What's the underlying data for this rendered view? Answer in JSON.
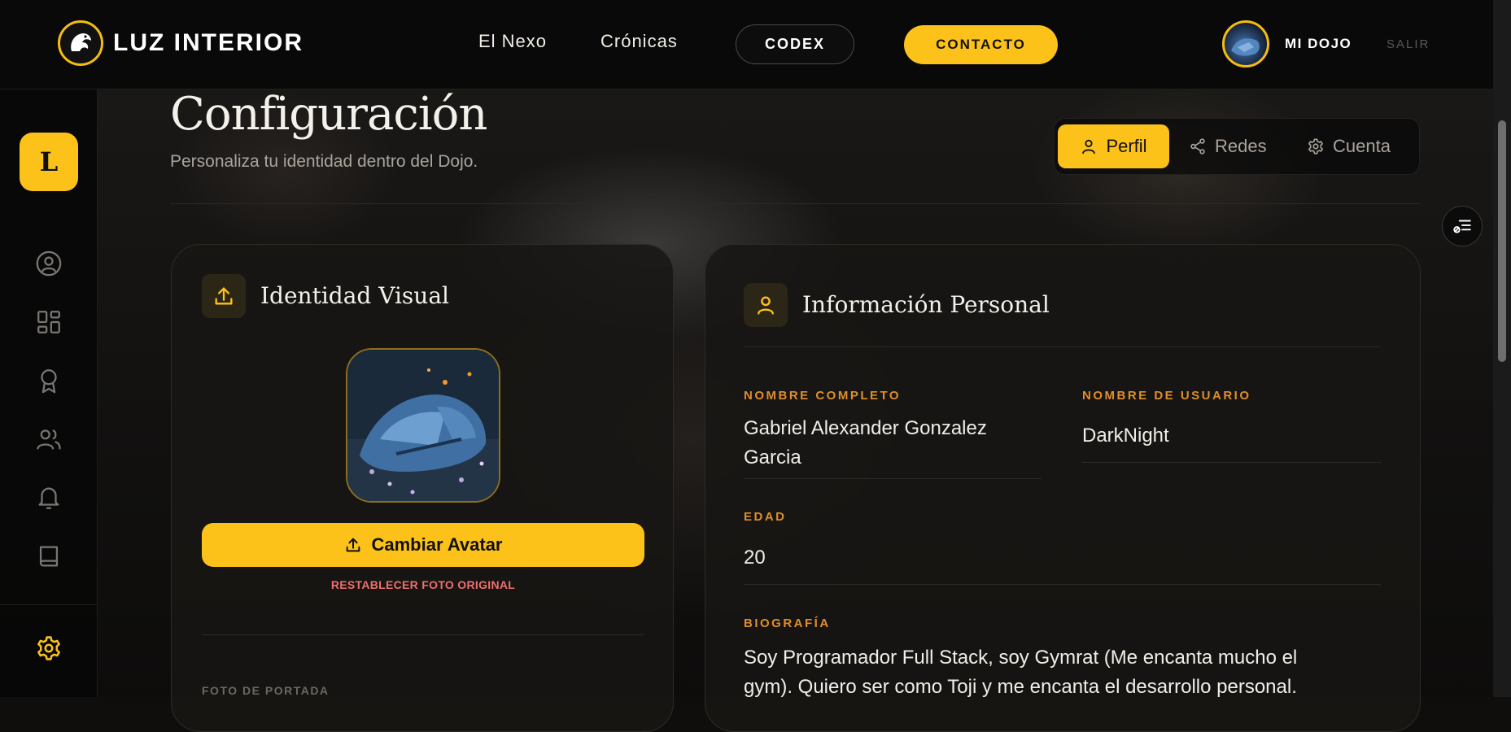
{
  "brand": {
    "name": "LUZ INTERIOR"
  },
  "nav": {
    "links": [
      "El Nexo",
      "Crónicas"
    ],
    "codex_label": "CODEX",
    "contact_label": "CONTACTO",
    "user_label": "MI DOJO",
    "logout_label": "SALIR"
  },
  "sidebar": {
    "initial": "L",
    "icons": [
      "user-circle-icon",
      "dashboard-icon",
      "award-icon",
      "users-icon",
      "bell-icon",
      "book-icon",
      "gear-icon"
    ]
  },
  "page": {
    "title": "Configuración",
    "subtitle": "Personaliza tu identidad dentro del Dojo."
  },
  "tabs": [
    {
      "label": "Perfil",
      "icon": "user-icon",
      "active": true
    },
    {
      "label": "Redes",
      "icon": "share-icon",
      "active": false
    },
    {
      "label": "Cuenta",
      "icon": "gear-icon",
      "active": false
    }
  ],
  "identity": {
    "title": "Identidad Visual",
    "change_avatar_label": "Cambiar Avatar",
    "restore_label": "RESTABLECER FOTO ORIGINAL",
    "cover_label": "FOTO DE PORTADA"
  },
  "personal": {
    "title": "Información Personal",
    "full_name_label": "NOMBRE COMPLETO",
    "full_name_line1": "Gabriel Alexander Gonzalez",
    "full_name_line2": "Garcia",
    "username_label": "NOMBRE DE USUARIO",
    "username": "DarkNight",
    "age_label": "EDAD",
    "age": "20",
    "bio_label": "BIOGRAFÍA",
    "bio_line1": "Soy Programador Full Stack, soy Gymrat (Me encanta mucho el",
    "bio_line2": "gym). Quiero ser como Toji y me encanta el desarrollo personal."
  },
  "colors": {
    "accent": "#fcc21a",
    "label": "#e08e2a",
    "danger": "#ef6f6f",
    "background": "#0f0e0c"
  }
}
